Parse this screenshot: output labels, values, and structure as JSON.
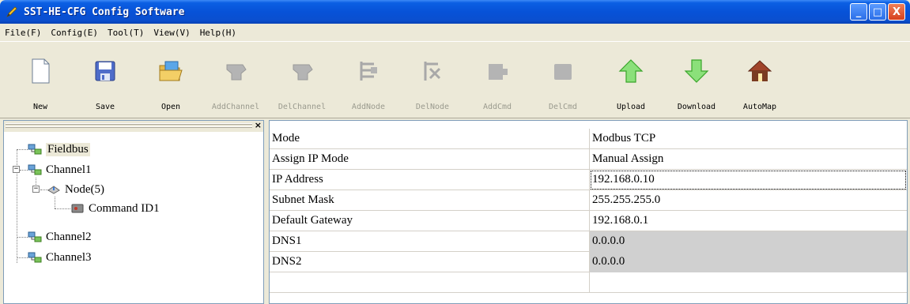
{
  "window": {
    "title": "SST-HE-CFG Config Software",
    "controls": {
      "minimize": "_",
      "maximize": "□",
      "close": "X"
    }
  },
  "menu": [
    "File(F)",
    "Config(E)",
    "Tool(T)",
    "View(V)",
    "Help(H)"
  ],
  "toolbar": [
    {
      "label": "New",
      "icon": "new-document-icon",
      "enabled": true
    },
    {
      "label": "Save",
      "icon": "floppy-disk-icon",
      "enabled": true
    },
    {
      "label": "Open",
      "icon": "open-folder-icon",
      "enabled": true
    },
    {
      "label": "AddChannel",
      "icon": "add-channel-icon",
      "enabled": false
    },
    {
      "label": "DelChannel",
      "icon": "delete-channel-icon",
      "enabled": false
    },
    {
      "label": "AddNode",
      "icon": "add-node-icon",
      "enabled": false
    },
    {
      "label": "DelNode",
      "icon": "delete-node-icon",
      "enabled": false
    },
    {
      "label": "AddCmd",
      "icon": "add-command-icon",
      "enabled": false
    },
    {
      "label": "DelCmd",
      "icon": "delete-command-icon",
      "enabled": false
    },
    {
      "label": "Upload",
      "icon": "upload-arrow-icon",
      "enabled": true
    },
    {
      "label": "Download",
      "icon": "download-arrow-icon",
      "enabled": true
    },
    {
      "label": "AutoMap",
      "icon": "house-icon",
      "enabled": true
    }
  ],
  "tree": {
    "close_label": "×",
    "items": [
      {
        "label": "Fieldbus",
        "icon": "network-icon",
        "selected": true
      },
      {
        "label": "Channel1",
        "icon": "network-icon",
        "expander": "−"
      },
      {
        "label": "Node(5)",
        "icon": "node-icon",
        "expander": "−"
      },
      {
        "label": "Command ID1",
        "icon": "command-icon"
      },
      {
        "label": "Channel2",
        "icon": "network-icon"
      },
      {
        "label": "Channel3",
        "icon": "network-icon"
      }
    ]
  },
  "properties": {
    "rows": [
      {
        "key": "Mode",
        "value": "Modbus TCP",
        "readonly": false
      },
      {
        "key": "Assign IP Mode",
        "value": "Manual Assign",
        "readonly": false
      },
      {
        "key": "IP Address",
        "value": "192.168.0.10",
        "readonly": false,
        "focused": true
      },
      {
        "key": "Subnet Mask",
        "value": "255.255.255.0",
        "readonly": false
      },
      {
        "key": "Default Gateway",
        "value": "192.168.0.1",
        "readonly": false
      },
      {
        "key": "DNS1",
        "value": "0.0.0.0",
        "readonly": true
      },
      {
        "key": "DNS2",
        "value": "0.0.0.0",
        "readonly": true
      },
      {
        "key": "",
        "value": "",
        "readonly": false
      }
    ]
  },
  "colors": {
    "titlebar": "#0752d8",
    "chrome": "#ece9d8",
    "readonly_cell": "#d0d0d0",
    "upload_green": "#5cc94a",
    "download_green": "#5cc94a"
  }
}
